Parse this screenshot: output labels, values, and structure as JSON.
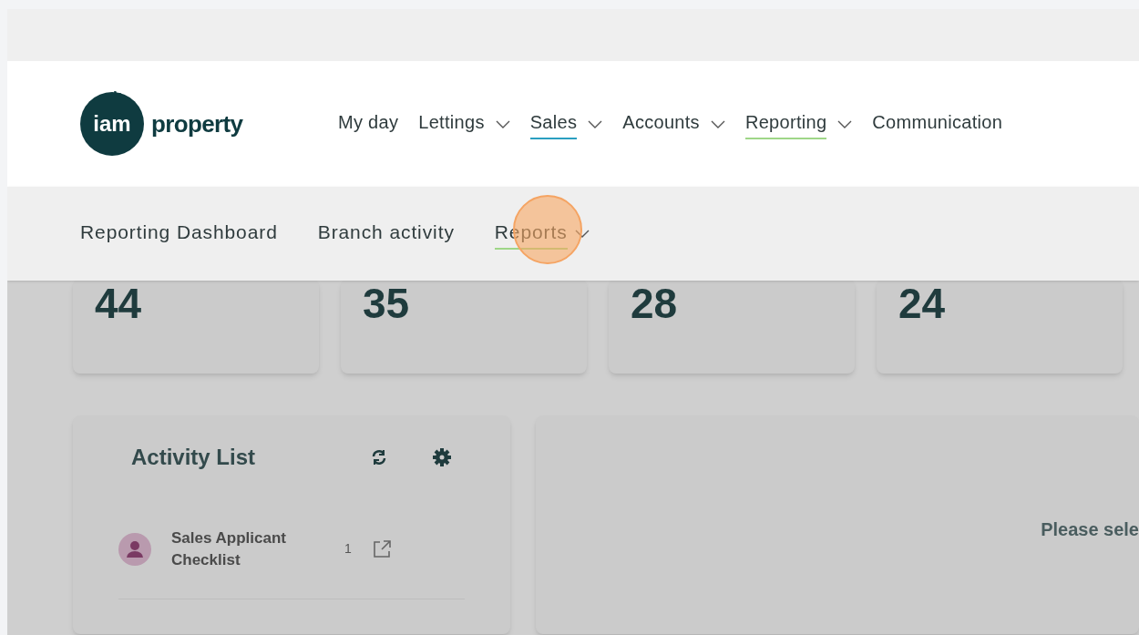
{
  "logo": {
    "mark": "iam",
    "word": "property"
  },
  "nav": [
    {
      "label": "My day",
      "dropdown": false
    },
    {
      "label": "Lettings",
      "dropdown": true
    },
    {
      "label": "Sales",
      "dropdown": true,
      "color": "#2a9fc0"
    },
    {
      "label": "Accounts",
      "dropdown": true
    },
    {
      "label": "Reporting",
      "dropdown": true,
      "color": "#9fd688"
    },
    {
      "label": "Communication",
      "dropdown": false
    }
  ],
  "subnav": [
    {
      "label": "Reporting Dashboard",
      "dropdown": false,
      "selected": false
    },
    {
      "label": "Branch activity",
      "dropdown": false,
      "selected": false
    },
    {
      "label": "Reports",
      "dropdown": true,
      "selected": true
    }
  ],
  "stats": [
    "44",
    "35",
    "28",
    "24"
  ],
  "activity_list": {
    "title": "Activity List",
    "items": [
      {
        "label": "Sales Applicant Checklist",
        "count": "1"
      }
    ]
  },
  "detail_panel": {
    "message": "Please sele"
  }
}
